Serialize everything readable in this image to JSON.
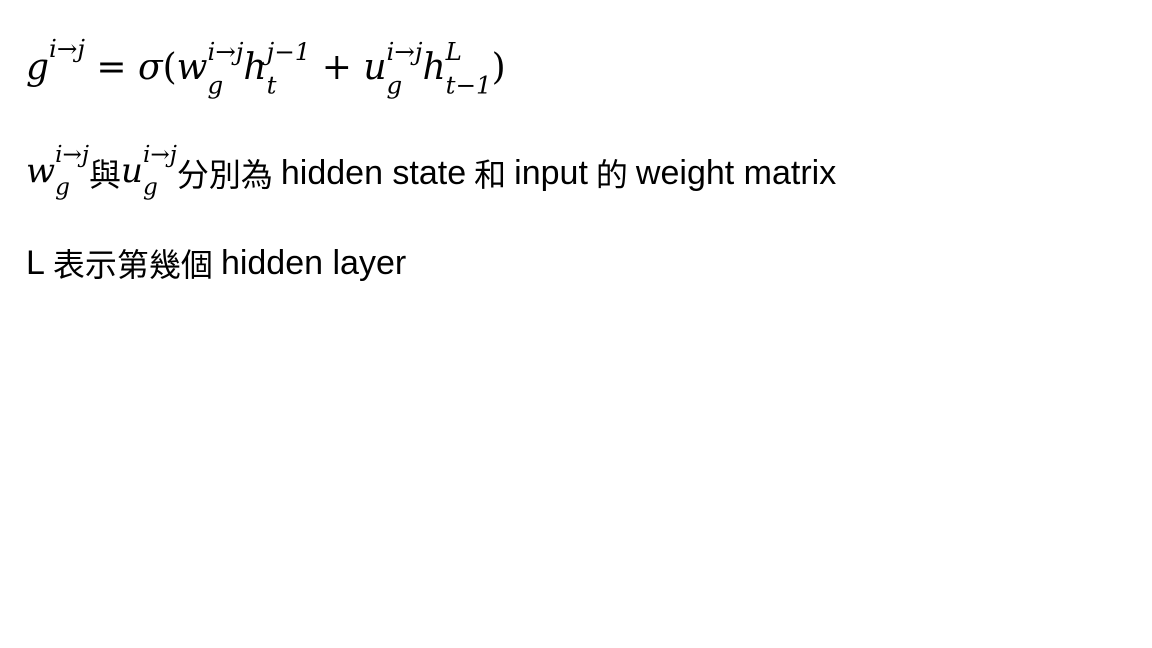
{
  "equation": {
    "lhs_base": "g",
    "lhs_sup": "i→j",
    "equals": "=",
    "sigma": "σ",
    "open_paren": "(",
    "w_base": "w",
    "w_sub": "g",
    "w_sup": "i→j",
    "h1_base": "h",
    "h1_sub": "t",
    "h1_sup": "j−1",
    "plus": "+",
    "u_base": "u",
    "u_sub": "g",
    "u_sup": "i→j",
    "h2_base": "h",
    "h2_sub": "t−1",
    "h2_sup": "L",
    "close_paren": ")"
  },
  "definition": {
    "w_base": "w",
    "w_sub": "g",
    "w_sup": "i→j",
    "and_text": "與",
    "u_base": "u",
    "u_sub": "g",
    "u_sup": "i→j",
    "text_1": "分別為",
    "text_2": "hidden state",
    "text_3": "和",
    "text_4": "input",
    "text_5": "的",
    "text_6": "weight matrix"
  },
  "layer_note": {
    "text_1": "L",
    "text_2": "表示第幾個",
    "text_3": "hidden layer"
  }
}
